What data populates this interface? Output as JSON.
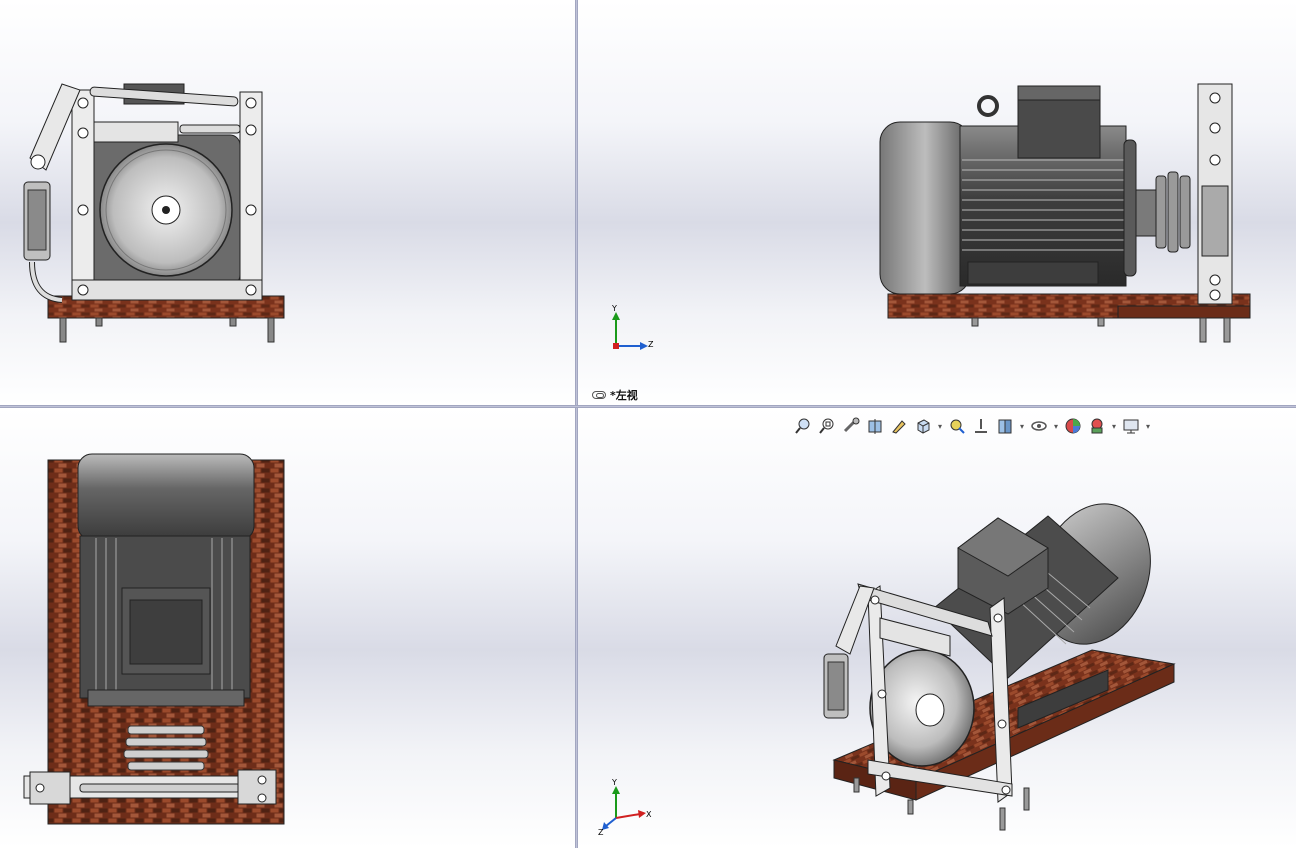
{
  "viewports": {
    "front": {
      "name": "front-view"
    },
    "left": {
      "name": "left-view",
      "label": "*左视"
    },
    "top": {
      "name": "top-view"
    },
    "iso": {
      "name": "isometric-view"
    }
  },
  "axes": {
    "left_view": {
      "y": "Y",
      "z": "Z"
    },
    "iso_view": {
      "y": "Y",
      "z": "Z",
      "x": "X"
    }
  },
  "toolbar": {
    "items": [
      "zoom-to-fit-icon",
      "zoom-to-area-icon",
      "previous-view-icon",
      "section-view-icon",
      "dynamic-annotation-icon",
      "view-orientation-icon",
      "dropdown",
      "display-style-icon",
      "hide-show-icon",
      "dropdown",
      "view-axis-icon",
      "edit-appearance-icon",
      "dropdown",
      "apply-scene-icon",
      "dropdown",
      "view-settings-icon",
      "dropdown"
    ]
  },
  "colors": {
    "brick": "#8a3b22",
    "metal": "#d8d8d8",
    "motor": "#555555",
    "accent": "#1f5fd0"
  }
}
